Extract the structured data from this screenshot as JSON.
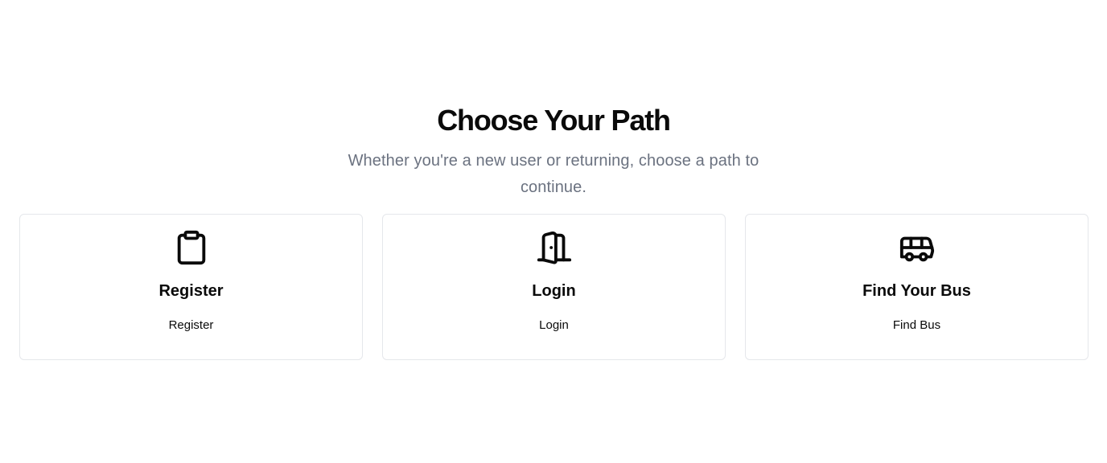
{
  "header": {
    "title": "Choose Your Path",
    "subtitle": "Whether you're a new user or returning, choose a path to continue."
  },
  "cards": [
    {
      "icon": "clipboard-icon",
      "title": "Register",
      "link_label": "Register"
    },
    {
      "icon": "door-icon",
      "title": "Login",
      "link_label": "Login"
    },
    {
      "icon": "bus-icon",
      "title": "Find Your Bus",
      "link_label": "Find Bus"
    }
  ],
  "colors": {
    "text": "#0a0a0a",
    "muted": "#6b7280",
    "border": "#e5e7eb",
    "background": "#ffffff"
  }
}
